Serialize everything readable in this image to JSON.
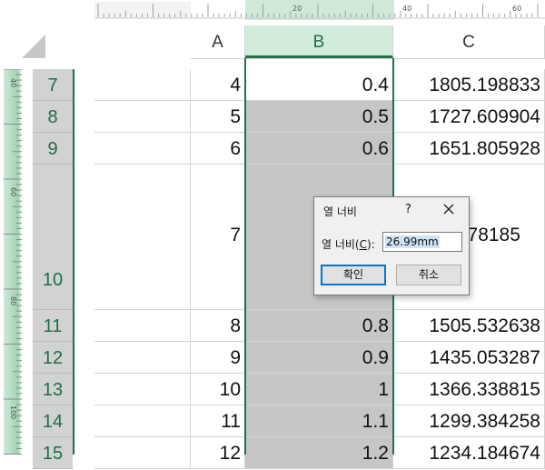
{
  "ruler": {
    "top_labels": [
      "20",
      "40",
      "60"
    ],
    "left_labels": [
      "40",
      "60",
      "80",
      "100"
    ]
  },
  "columns": [
    "A",
    "B",
    "C"
  ],
  "selected_column": "B",
  "rows": [
    {
      "num": "7",
      "a": "4",
      "b": "0.4",
      "c": "1805.198833"
    },
    {
      "num": "8",
      "a": "5",
      "b": "0.5",
      "c": "1727.609904"
    },
    {
      "num": "9",
      "a": "6",
      "b": "0.6",
      "c": "1651.805928"
    },
    {
      "num": "10",
      "a": "7",
      "b": "",
      "c": "7.78185"
    },
    {
      "num": "11",
      "a": "8",
      "b": "0.8",
      "c": "1505.532638"
    },
    {
      "num": "12",
      "a": "9",
      "b": "0.9",
      "c": "1435.053287"
    },
    {
      "num": "13",
      "a": "10",
      "b": "1",
      "c": "1366.338815"
    },
    {
      "num": "14",
      "a": "11",
      "b": "1.1",
      "c": "1299.384258"
    },
    {
      "num": "15",
      "a": "12",
      "b": "1.2",
      "c": "1234.184674"
    }
  ],
  "dialog": {
    "title": "열 너비",
    "help": "?",
    "label_prefix": "열 너비(",
    "label_key": "C",
    "label_suffix": "):",
    "value": "26.99mm",
    "ok": "확인",
    "cancel": "취소"
  },
  "colors": {
    "accent": "#217346",
    "selected_header_bg": "#d2ecdc",
    "selected_cell_bg": "#c6c6c6",
    "dialog_default_border": "#0078d7"
  }
}
